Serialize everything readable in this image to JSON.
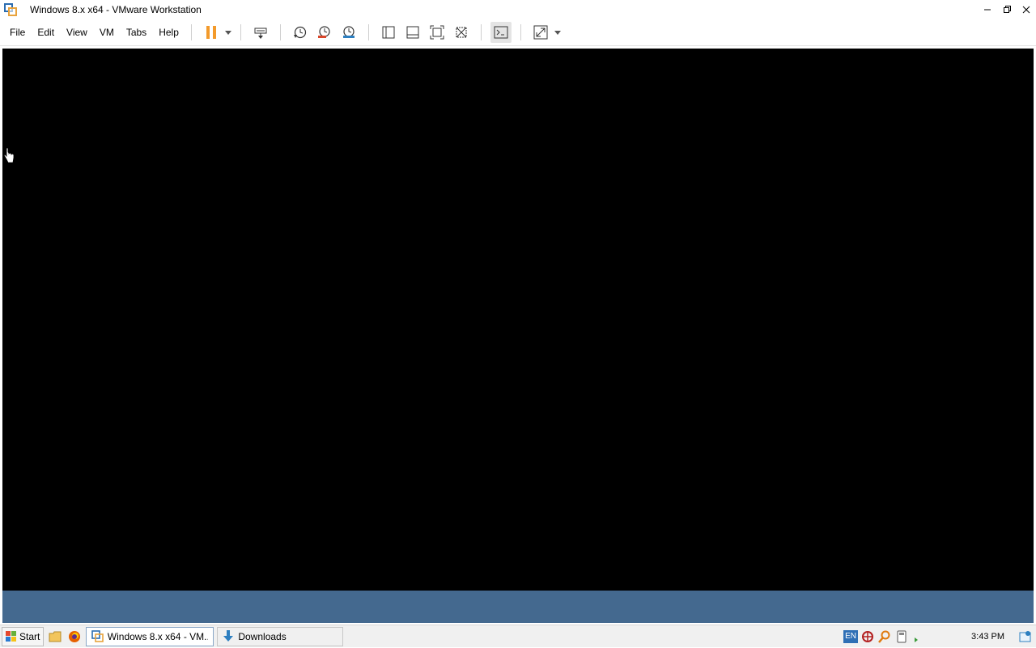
{
  "window": {
    "title": "Windows 8.x x64 - VMware Workstation"
  },
  "menu": [
    {
      "label": "File"
    },
    {
      "label": "Edit"
    },
    {
      "label": "View"
    },
    {
      "label": "VM"
    },
    {
      "label": "Tabs"
    },
    {
      "label": "Help"
    }
  ],
  "toolbar_icons": [
    "pause-icon",
    "send-ctrl-alt-del-icon",
    "snapshot-icon",
    "revert-snapshot-icon",
    "snapshot-manager-icon",
    "library-icon",
    "thumbnail-bar-icon",
    "full-screen-icon",
    "unity-icon",
    "console-view-icon",
    "stretch-guest-icon"
  ],
  "colors": {
    "vm_screen": "#000000",
    "vm_bottom_band": "#44698f",
    "pause_orange": "#f39a2b",
    "snapshot_red": "#d9472b",
    "snapshot_blue": "#2d7fc0"
  },
  "taskbar": {
    "start_label": "Start",
    "tasks": [
      {
        "label": "Windows 8.x x64 - VM...",
        "icon": "vmware-icon",
        "active": true
      },
      {
        "label": "Downloads",
        "icon": "download-arrow-icon",
        "active": false
      }
    ],
    "tray": {
      "language": "EN",
      "clock": "3:43 PM"
    }
  }
}
